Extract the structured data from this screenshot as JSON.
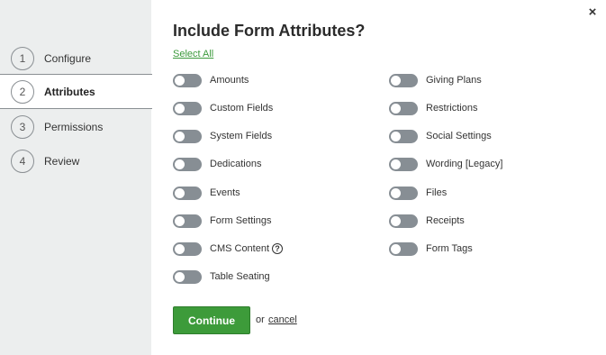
{
  "close_label": "×",
  "steps": [
    {
      "num": "1",
      "label": "Configure"
    },
    {
      "num": "2",
      "label": "Attributes"
    },
    {
      "num": "3",
      "label": "Permissions"
    },
    {
      "num": "4",
      "label": "Review"
    }
  ],
  "title": "Include Form Attributes?",
  "select_all": "Select All",
  "left_toggles": [
    {
      "label": "Amounts"
    },
    {
      "label": "Custom Fields"
    },
    {
      "label": "System Fields"
    },
    {
      "label": "Dedications"
    },
    {
      "label": "Events"
    },
    {
      "label": "Form Settings"
    },
    {
      "label": "CMS Content",
      "help": "?"
    },
    {
      "label": "Table Seating"
    }
  ],
  "right_toggles": [
    {
      "label": "Giving Plans"
    },
    {
      "label": "Restrictions"
    },
    {
      "label": "Social Settings"
    },
    {
      "label": "Wording [Legacy]"
    },
    {
      "label": "Files"
    },
    {
      "label": "Receipts"
    },
    {
      "label": "Form Tags"
    }
  ],
  "footer": {
    "continue": "Continue",
    "or": "or",
    "cancel": "cancel"
  },
  "colors": {
    "accent_green": "#3d9b3a",
    "toggle_off": "#878e94",
    "sidebar_bg": "#eceeee"
  }
}
